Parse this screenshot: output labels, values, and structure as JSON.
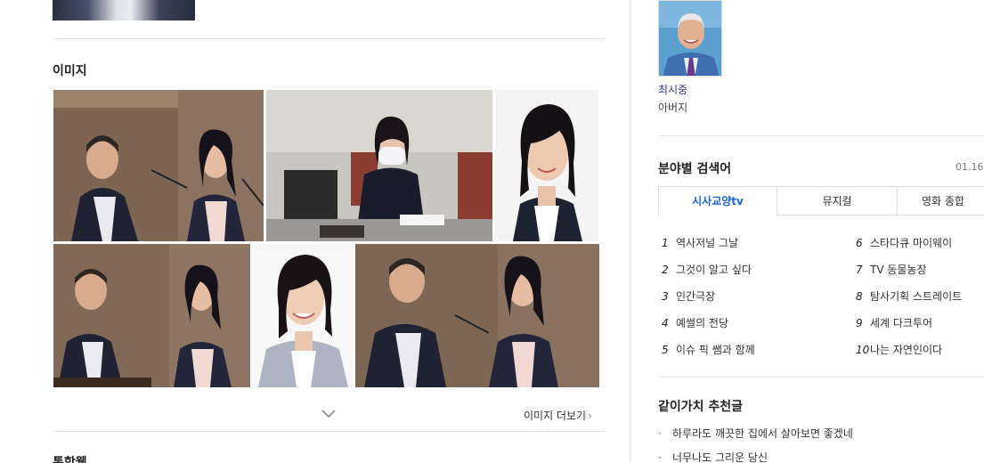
{
  "images_section": {
    "title": "이미지",
    "more_label": "이미지 더보기",
    "more_arrow": "›"
  },
  "next_section_title": "통합웹",
  "person": {
    "name": "최시중",
    "relation": "아버지"
  },
  "keywords": {
    "title": "분야별 검색어",
    "date": "01.16.",
    "tabs": [
      "시사교양tv",
      "뮤지컬",
      "영화 종합"
    ],
    "ranks": [
      {
        "num": "1",
        "label": "역사저널 그날"
      },
      {
        "num": "2",
        "label": "그것이 알고 싶다"
      },
      {
        "num": "3",
        "label": "인간극장"
      },
      {
        "num": "4",
        "label": "예썰의 전당"
      },
      {
        "num": "5",
        "label": "이슈 픽 쌤과 함께"
      },
      {
        "num": "6",
        "label": "스타다큐 마이웨이"
      },
      {
        "num": "7",
        "label": "TV 동물농장"
      },
      {
        "num": "8",
        "label": "탐사기획 스트레이트"
      },
      {
        "num": "9",
        "label": "세계 다크투어"
      },
      {
        "num": "10",
        "label": "나는 자연인이다"
      }
    ]
  },
  "recommend": {
    "title": "같이가치 추천글",
    "bullet": "·",
    "items": [
      "하루라도 깨끗한 집에서 살아보면 좋겠네",
      "너무나도 그리운 당신"
    ]
  },
  "colors": {
    "active_tab": "#1a66d6",
    "person_link": "#2f3c8c"
  }
}
